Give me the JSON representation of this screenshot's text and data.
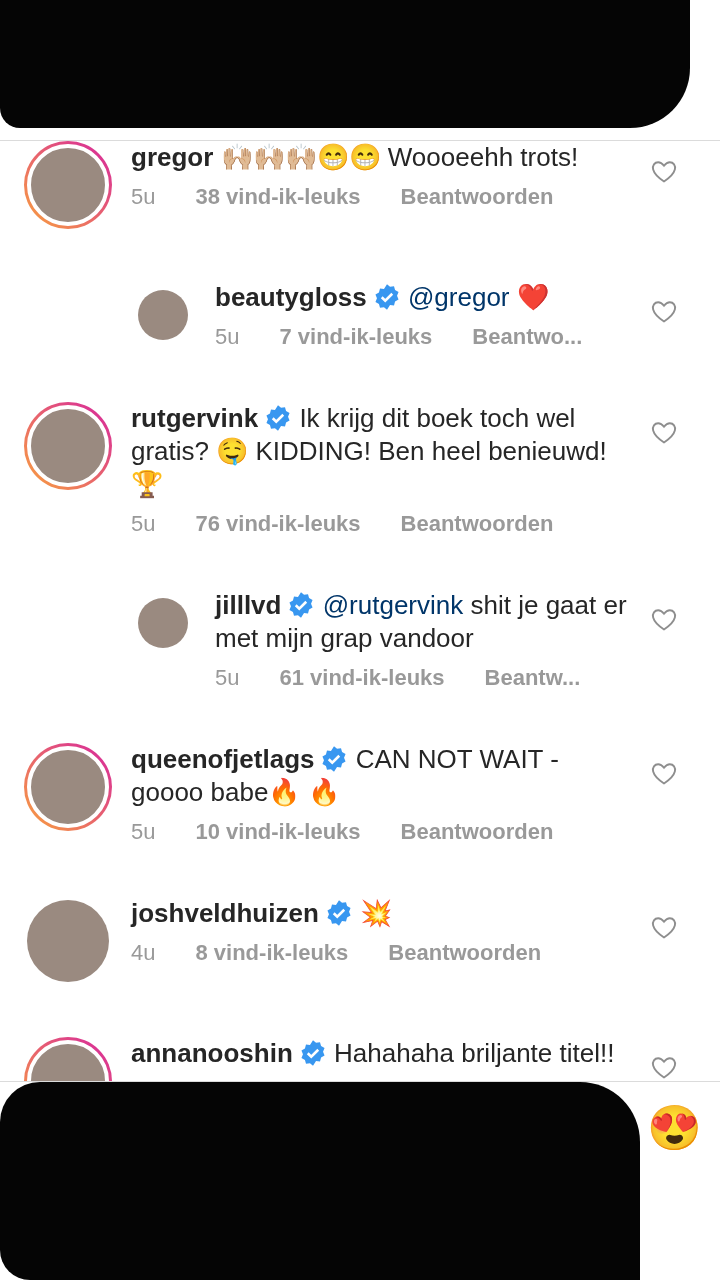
{
  "comments": [
    {
      "kind": "comment",
      "story_ring": true,
      "username": "gregor",
      "verified": false,
      "text": "🙌🏼🙌🏼🙌🏼😁😁 Woooeehh trots!",
      "time": "5u",
      "likes": "38 vind-ik-leuks",
      "reply": "Beantwoorden"
    },
    {
      "kind": "reply",
      "story_ring": false,
      "username": "beautygloss",
      "verified": true,
      "mention": "@gregor",
      "text": "❤️",
      "time": "5u",
      "likes": "7 vind-ik-leuks",
      "reply": "Beantwo..."
    },
    {
      "kind": "comment",
      "story_ring": true,
      "username": "rutgervink",
      "verified": true,
      "text": "Ik krijg dit boek toch wel gratis? 🤤 KIDDING! Ben heel benieuwd! 🏆",
      "time": "5u",
      "likes": "76 vind-ik-leuks",
      "reply": "Beantwoorden"
    },
    {
      "kind": "reply",
      "story_ring": false,
      "username": "jilllvd",
      "verified": true,
      "mention": "@rutgervink",
      "text": "shit je gaat er met mijn grap vandoor",
      "time": "5u",
      "likes": "61 vind-ik-leuks",
      "reply": "Beantw..."
    },
    {
      "kind": "comment",
      "story_ring": true,
      "username": "queenofjetlags",
      "verified": true,
      "text": "CAN NOT WAIT - goooo babe🔥 🔥",
      "time": "5u",
      "likes": "10 vind-ik-leuks",
      "reply": "Beantwoorden"
    },
    {
      "kind": "comment",
      "story_ring": false,
      "username": "joshveldhuizen",
      "verified": true,
      "text": "💥",
      "time": "4u",
      "likes": "8 vind-ik-leuks",
      "reply": "Beantwoorden"
    },
    {
      "kind": "comment",
      "story_ring": true,
      "username": "annanooshin",
      "verified": true,
      "text": "Hahahaha briljante titel!!"
    }
  ],
  "quick_reaction": "😍"
}
